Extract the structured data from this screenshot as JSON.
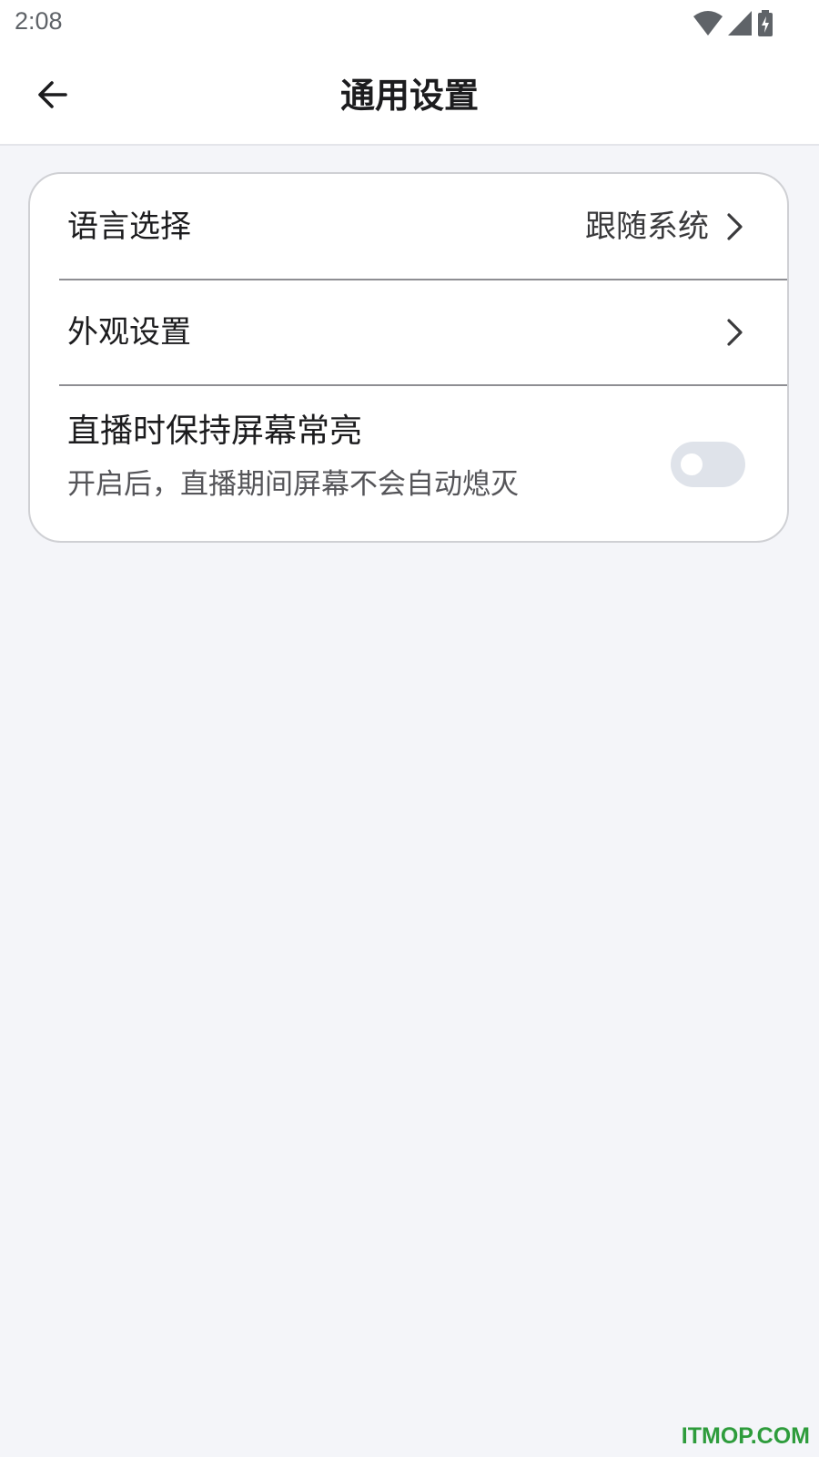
{
  "status_bar": {
    "time": "2:08",
    "icons": [
      "wifi-icon",
      "signal-icon",
      "battery-charging-icon"
    ]
  },
  "app_bar": {
    "title": "通用设置",
    "back_icon": "arrow-left-icon"
  },
  "settings": {
    "language": {
      "label": "语言选择",
      "value": "跟随系统"
    },
    "appearance": {
      "label": "外观设置"
    },
    "keep_screen_on": {
      "label": "直播时保持屏幕常亮",
      "description": "开启后，直播期间屏幕不会自动熄灭",
      "enabled": false
    }
  },
  "watermark": "ITMOP.COM",
  "colors": {
    "background": "#f4f5f9",
    "card": "#ffffff",
    "toggle_off": "#dfe3ea",
    "watermark": "#2e9c3c"
  }
}
